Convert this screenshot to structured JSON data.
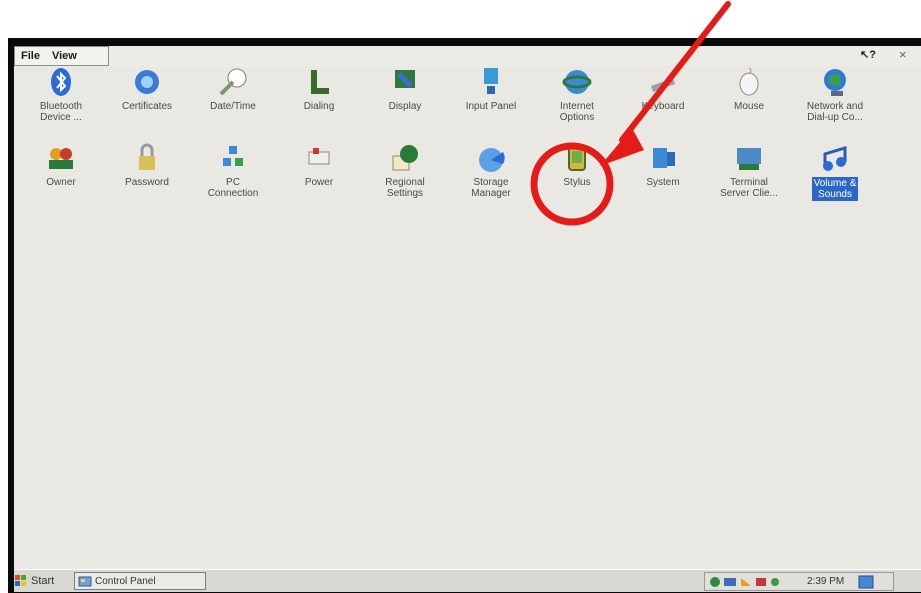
{
  "menu": {
    "file": "File",
    "view": "View",
    "help": "?",
    "close": "×"
  },
  "icons": [
    {
      "label": "Bluetooth\nDevice ...",
      "icon": "bluetooth-icon"
    },
    {
      "label": "Certificates",
      "icon": "certificates-icon"
    },
    {
      "label": "Date/Time",
      "icon": "datetime-icon"
    },
    {
      "label": "Dialing",
      "icon": "dialing-icon"
    },
    {
      "label": "Display",
      "icon": "display-icon"
    },
    {
      "label": "Input Panel",
      "icon": "input-panel-icon"
    },
    {
      "label": "Internet\nOptions",
      "icon": "internet-options-icon"
    },
    {
      "label": "Keyboard",
      "icon": "keyboard-icon"
    },
    {
      "label": "Mouse",
      "icon": "mouse-icon"
    },
    {
      "label": "Network and\nDial-up Co...",
      "icon": "network-icon"
    },
    {
      "label": "Owner",
      "icon": "owner-icon"
    },
    {
      "label": "Password",
      "icon": "password-icon"
    },
    {
      "label": "PC\nConnection",
      "icon": "pc-connection-icon"
    },
    {
      "label": "Power",
      "icon": "power-icon"
    },
    {
      "label": "Regional\nSettings",
      "icon": "regional-settings-icon"
    },
    {
      "label": "Storage\nManager",
      "icon": "storage-manager-icon"
    },
    {
      "label": "Stylus",
      "icon": "stylus-icon"
    },
    {
      "label": "System",
      "icon": "system-icon"
    },
    {
      "label": "Terminal\nServer Clie...",
      "icon": "terminal-server-icon"
    },
    {
      "label": "Volume &\nSounds",
      "icon": "volume-sounds-icon",
      "selected": true
    }
  ],
  "taskbar": {
    "start": "Start",
    "task": "Control Panel",
    "time": "2:39 PM"
  },
  "colors": {
    "highlight": "#e41b17",
    "selection": "#2a68c8"
  }
}
